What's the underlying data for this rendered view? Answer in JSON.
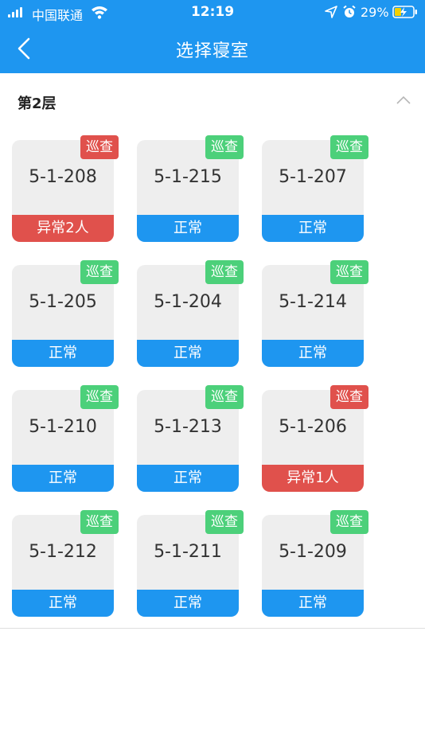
{
  "status": {
    "carrier": "中国联通",
    "time": "12:19",
    "battery": "29%"
  },
  "nav": {
    "title": "选择寝室"
  },
  "floor": {
    "label": "第2层"
  },
  "colors": {
    "primary": "#1e96f0",
    "normal": "#1e96f0",
    "abnormal": "#e0514c",
    "badge_green": "#4cd07a",
    "badge_red": "#e0514c"
  },
  "rooms": [
    {
      "room": "5-1-208",
      "status": "异常2人",
      "badge": "巡查"
    },
    {
      "room": "5-1-215",
      "status": "正常",
      "badge": "巡查"
    },
    {
      "room": "5-1-207",
      "status": "正常",
      "badge": "巡查"
    },
    {
      "room": "5-1-205",
      "status": "正常",
      "badge": "巡查"
    },
    {
      "room": "5-1-204",
      "status": "正常",
      "badge": "巡查"
    },
    {
      "room": "5-1-214",
      "status": "正常",
      "badge": "巡查"
    },
    {
      "room": "5-1-210",
      "status": "正常",
      "badge": "巡查"
    },
    {
      "room": "5-1-213",
      "status": "正常",
      "badge": "巡查"
    },
    {
      "room": "5-1-206",
      "status": "异常1人",
      "badge": "巡查"
    },
    {
      "room": "5-1-212",
      "status": "正常",
      "badge": "巡查"
    },
    {
      "room": "5-1-211",
      "status": "正常",
      "badge": "巡查"
    },
    {
      "room": "5-1-209",
      "status": "正常",
      "badge": "巡查"
    }
  ]
}
